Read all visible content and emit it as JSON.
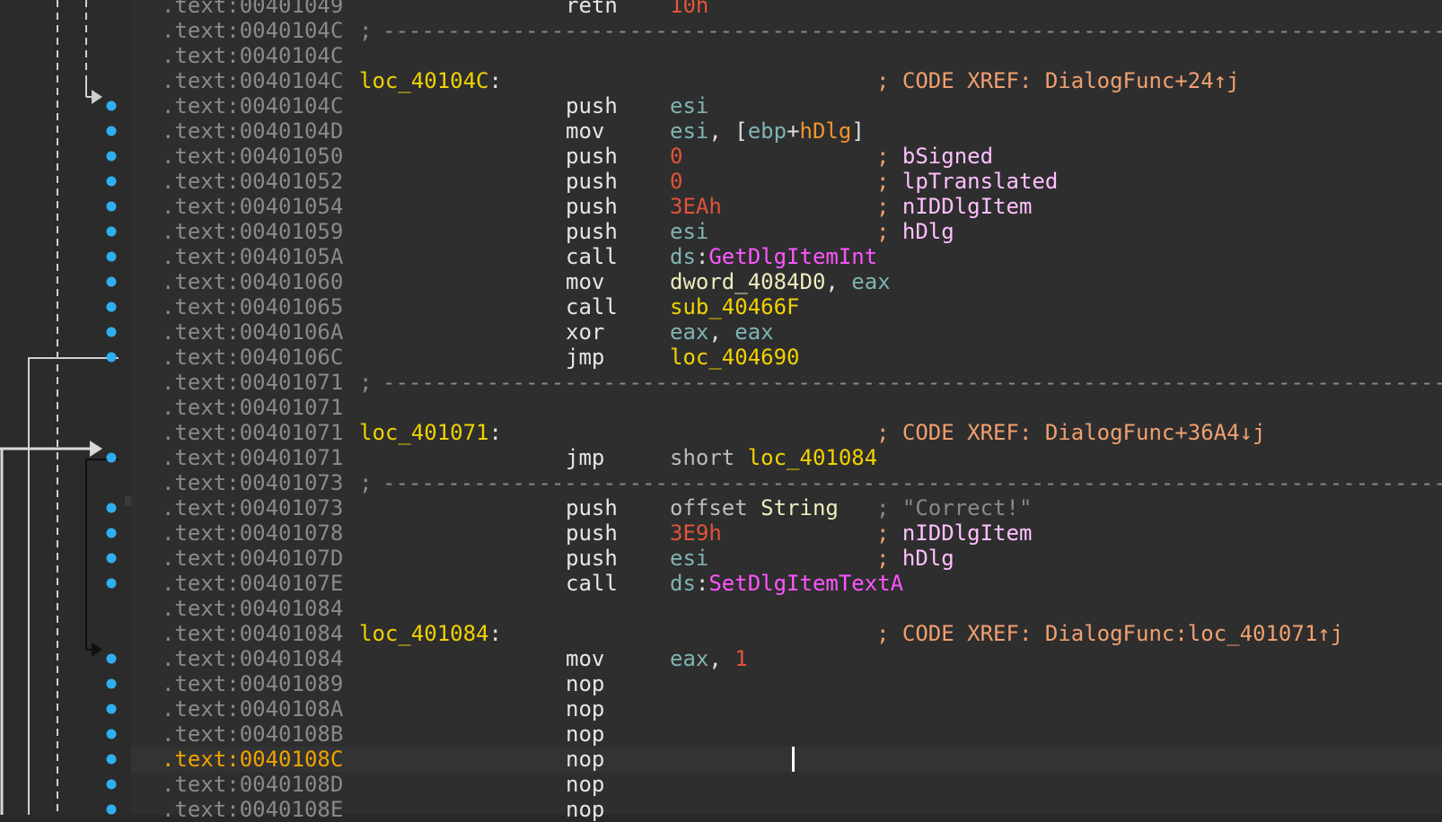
{
  "colors": {
    "background": "#2e2e2e",
    "address": "#8a8a8a",
    "current_address": "#f0a300",
    "label": "#f2d200",
    "register": "#7fb3b3",
    "number": "#e0533a",
    "api": "#ff55ff",
    "comment": "#f0a070",
    "arg_comment": "#ffc0ff",
    "node": "#2eb0f0"
  },
  "separator_dashes": "-----------------------------------------------------------------------------------",
  "lines": [
    {
      "addr": ".text:00401049",
      "mnem": "retn",
      "ops": [
        [
          "num",
          "10h"
        ]
      ]
    },
    {
      "addr": ".text:0040104C",
      "sep": true
    },
    {
      "addr": ".text:0040104C"
    },
    {
      "addr": ".text:0040104C",
      "label": "loc_40104C",
      "cmt": [
        [
          "semi",
          "; "
        ],
        [
          "xref",
          "CODE XREF: DialogFunc+24↑j"
        ]
      ]
    },
    {
      "addr": ".text:0040104C",
      "mnem": "push",
      "ops": [
        [
          "reg",
          "esi"
        ]
      ]
    },
    {
      "addr": ".text:0040104D",
      "mnem": "mov",
      "ops": [
        [
          "reg",
          "esi"
        ],
        [
          "punc",
          ", ["
        ],
        [
          "reg",
          "ebp"
        ],
        [
          "punc",
          "+"
        ],
        [
          "var",
          "hDlg"
        ],
        [
          "punc",
          "]"
        ]
      ]
    },
    {
      "addr": ".text:00401050",
      "mnem": "push",
      "ops": [
        [
          "num",
          "0"
        ]
      ],
      "cmt": [
        [
          "semi",
          "; "
        ],
        [
          "argc",
          "bSigned"
        ]
      ]
    },
    {
      "addr": ".text:00401052",
      "mnem": "push",
      "ops": [
        [
          "num",
          "0"
        ]
      ],
      "cmt": [
        [
          "semi",
          "; "
        ],
        [
          "argc",
          "lpTranslated"
        ]
      ]
    },
    {
      "addr": ".text:00401054",
      "mnem": "push",
      "ops": [
        [
          "num",
          "3EAh"
        ]
      ],
      "cmt": [
        [
          "semi",
          "; "
        ],
        [
          "argc",
          "nIDDlgItem"
        ]
      ]
    },
    {
      "addr": ".text:00401059",
      "mnem": "push",
      "ops": [
        [
          "reg",
          "esi"
        ]
      ],
      "cmt": [
        [
          "semi",
          "; "
        ],
        [
          "argc",
          "hDlg"
        ]
      ]
    },
    {
      "addr": ".text:0040105A",
      "mnem": "call",
      "ops": [
        [
          "reg",
          "ds"
        ],
        [
          "punc",
          ":"
        ],
        [
          "api",
          "GetDlgItemInt"
        ]
      ]
    },
    {
      "addr": ".text:00401060",
      "mnem": "mov",
      "ops": [
        [
          "plain",
          "dword_4084D0"
        ],
        [
          "punc",
          ", "
        ],
        [
          "reg",
          "eax"
        ]
      ]
    },
    {
      "addr": ".text:00401065",
      "mnem": "call",
      "ops": [
        [
          "loc",
          "sub_40466F"
        ]
      ]
    },
    {
      "addr": ".text:0040106A",
      "mnem": "xor",
      "ops": [
        [
          "reg",
          "eax"
        ],
        [
          "punc",
          ", "
        ],
        [
          "reg",
          "eax"
        ]
      ]
    },
    {
      "addr": ".text:0040106C",
      "mnem": "jmp",
      "ops": [
        [
          "loc",
          "loc_404690"
        ]
      ]
    },
    {
      "addr": ".text:00401071",
      "sep": true
    },
    {
      "addr": ".text:00401071"
    },
    {
      "addr": ".text:00401071",
      "label": "loc_401071",
      "cmt": [
        [
          "semi",
          "; "
        ],
        [
          "xref",
          "CODE XREF: DialogFunc+36A4↓j"
        ]
      ]
    },
    {
      "addr": ".text:00401071",
      "mnem": "jmp",
      "ops": [
        [
          "kw",
          "short "
        ],
        [
          "loc",
          "loc_401084"
        ]
      ]
    },
    {
      "addr": ".text:00401073",
      "sep": true
    },
    {
      "addr": ".text:00401073",
      "mnem": "push",
      "ops": [
        [
          "kw",
          "offset "
        ],
        [
          "plain",
          "String"
        ]
      ],
      "cmt": [
        [
          "strc",
          "; \"Correct!\""
        ]
      ]
    },
    {
      "addr": ".text:00401078",
      "mnem": "push",
      "ops": [
        [
          "num",
          "3E9h"
        ]
      ],
      "cmt": [
        [
          "semi",
          "; "
        ],
        [
          "argc",
          "nIDDlgItem"
        ]
      ]
    },
    {
      "addr": ".text:0040107D",
      "mnem": "push",
      "ops": [
        [
          "reg",
          "esi"
        ]
      ],
      "cmt": [
        [
          "semi",
          "; "
        ],
        [
          "argc",
          "hDlg"
        ]
      ]
    },
    {
      "addr": ".text:0040107E",
      "mnem": "call",
      "ops": [
        [
          "reg",
          "ds"
        ],
        [
          "punc",
          ":"
        ],
        [
          "api",
          "SetDlgItemTextA"
        ]
      ]
    },
    {
      "addr": ".text:00401084"
    },
    {
      "addr": ".text:00401084",
      "label": "loc_401084",
      "cmt": [
        [
          "semi",
          "; "
        ],
        [
          "xref",
          "CODE XREF: DialogFunc:loc_401071↑j"
        ]
      ]
    },
    {
      "addr": ".text:00401084",
      "mnem": "mov",
      "ops": [
        [
          "reg",
          "eax"
        ],
        [
          "punc",
          ", "
        ],
        [
          "num",
          "1"
        ]
      ]
    },
    {
      "addr": ".text:00401089",
      "mnem": "nop"
    },
    {
      "addr": ".text:0040108A",
      "mnem": "nop"
    },
    {
      "addr": ".text:0040108B",
      "mnem": "nop"
    },
    {
      "addr": ".text:0040108C",
      "mnem": "nop",
      "current": true
    },
    {
      "addr": ".text:0040108D",
      "mnem": "nop"
    },
    {
      "addr": ".text:0040108E",
      "mnem": "nop"
    }
  ]
}
